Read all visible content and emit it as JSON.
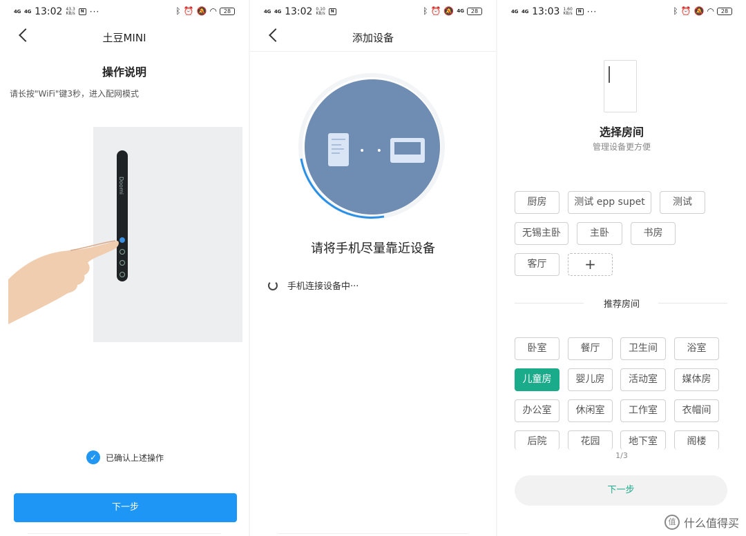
{
  "panel1": {
    "status": {
      "sig1": "4G",
      "sig2": "4G",
      "time": "13:02",
      "speed": "43.3\nKB/s",
      "nfc": "N",
      "battery": "28"
    },
    "nav": {
      "title": "土豆MINI"
    },
    "heading": "操作说明",
    "instruction": "请长按\"WiFi\"键3秒，进入配网模式",
    "device_brand": "Doomi",
    "confirm_text": "已确认上述操作",
    "next_button": "下一步"
  },
  "panel2": {
    "status": {
      "sig1": "4G",
      "sig2": "4G",
      "time": "13:02",
      "speed": "0.10\nKB/s",
      "nfc": "N",
      "net": "4G",
      "battery": "28"
    },
    "nav": {
      "title": "添加设备"
    },
    "message": "请将手机尽量靠近设备",
    "loading_text": "手机连接设备中···"
  },
  "panel3": {
    "status": {
      "sig1": "4G",
      "sig2": "4G",
      "time": "13:03",
      "speed": "1.60\nKB/s",
      "nfc": "N",
      "battery": "28"
    },
    "title": "选择房间",
    "subtitle": "管理设备更方便",
    "my_rooms": [
      "厨房",
      "测试 epp supet",
      "测试",
      "无锡主卧",
      "主卧",
      "书房",
      "客厅"
    ],
    "add_label": "+",
    "recommend_title": "推荐房间",
    "recommended": [
      "卧室",
      "餐厅",
      "卫生间",
      "浴室",
      "儿童房",
      "婴儿房",
      "活动室",
      "媒体房",
      "办公室",
      "休闲室",
      "工作室",
      "衣帽间",
      "后院",
      "花园",
      "地下室",
      "阁楼"
    ],
    "selected_room": "儿童房",
    "page_indicator": "1/3",
    "next_button": "下一步"
  },
  "watermark": "什么值得买",
  "colors": {
    "primary_blue": "#1e96f5",
    "accent_green": "#1aab8a",
    "circle": "#6f8cb2"
  }
}
